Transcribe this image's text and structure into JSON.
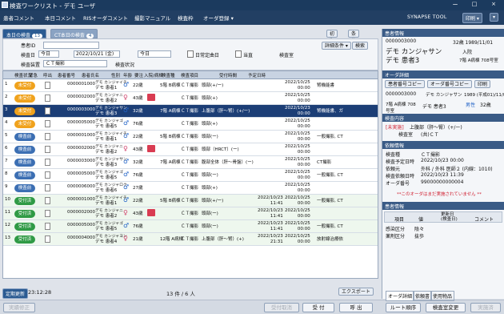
{
  "titlebar": {
    "title": "検査ワークリスト - デモ ユーザ",
    "min": "ー",
    "max": "□",
    "close": "×"
  },
  "menu": {
    "items": [
      "患者コメント",
      "本日コメント",
      "RISオーダコメント",
      "撮影マニュアル",
      "検査枠",
      "オーダ登録 ▾"
    ],
    "brand": "SYNAPSE TOOL",
    "print": "印刷 ▾",
    "more": "▾"
  },
  "tabs": {
    "tab1": "本日の検査",
    "tab1_count": "13",
    "tab2": "CT本日の検査",
    "tab2_count": "4"
  },
  "filters": {
    "init_label": "初期化",
    "cond_label": "条件リスト選択",
    "patient_id_label": "患者ID",
    "exam_date_label": "検査日",
    "date_type": "今日",
    "date_from": "2022/10/21 (金)",
    "date_to": "今日",
    "same_day": "日常定曲日",
    "inpatient": "当直",
    "exam_room_label": "検査室",
    "detail_btn": "詳細条件 ▾",
    "search_btn": "検索",
    "modality_label": "検査装置",
    "modality_value": "ＣＴ撮影",
    "status_label": "検査状況"
  },
  "grid": {
    "headers": [
      "検査状況",
      "緊急",
      "呼出",
      "患者番号",
      "患者氏名",
      "性別",
      "年齢",
      "要注",
      "入院/病棟",
      "検査種",
      "検査項目",
      "受付時間",
      "予定日時",
      ""
    ],
    "rows": [
      {
        "no": "1",
        "status": "未受付",
        "status_color": "o",
        "pid": "0000001000",
        "name_k": "デモ カンジャイチ",
        "name": "デモ 患者1",
        "sex": "m",
        "age": "22歳",
        "flag": false,
        "ward": "5階 B病棟",
        "kind": "ＣＴ撮影",
        "item": "頭部(+/ー)",
        "recv": "",
        "date": "2022/10/25\n00:00",
        "note": "腎機能書"
      },
      {
        "no": "2",
        "status": "未受付",
        "status_color": "o",
        "pid": "0000002000",
        "name_k": "デモ カンジャニ",
        "name": "デモ 患者2",
        "sex": "f",
        "age": "43歳",
        "flag": true,
        "ward": "",
        "kind": "ＣＴ撮影",
        "item": "頭部(+)",
        "recv": "",
        "date": "2022/10/25\n00:00",
        "note": ""
      },
      {
        "no": "3",
        "status": "未受付",
        "status_color": "o",
        "pid": "0000003000",
        "name_k": "デモ カンジャサン",
        "name": "デモ 患者3",
        "sex": "m",
        "age": "32歳",
        "flag": false,
        "ward": "7階 A病棟",
        "kind": "ＣＴ撮影",
        "item": "上腹部（肝〜腎）(+/ー)",
        "recv": "",
        "date": "2022/10/23\n00:00",
        "note": "腎機能書、ガ"
      },
      {
        "no": "4",
        "status": "未受付",
        "status_color": "o",
        "pid": "0000005000",
        "name_k": "デモ カンジャゴ",
        "name": "デモ 患者5",
        "sex": "m",
        "age": "76歳",
        "flag": false,
        "ward": "",
        "kind": "ＣＴ撮影",
        "item": "頭部(+)",
        "recv": "",
        "date": "2022/10/25\n00:00",
        "note": ""
      },
      {
        "no": "5",
        "status": "検査前",
        "status_color": "b",
        "pid": "0000001000",
        "name_k": "デモ カンジャイチ",
        "name": "デモ 患者1",
        "sex": "m",
        "age": "22歳",
        "flag": false,
        "ward": "5階 B病棟",
        "kind": "ＣＴ撮影",
        "item": "頭部(ー)",
        "recv": "",
        "date": "2022/10/25\n00:00",
        "note": "一般撮影, CT"
      },
      {
        "no": "6",
        "status": "検査前",
        "status_color": "b",
        "pid": "0000002000",
        "name_k": "デモ カンジャニ",
        "name": "デモ 患者2",
        "sex": "f",
        "age": "43歳",
        "flag": true,
        "ward": "",
        "kind": "ＣＴ撮影",
        "item": "頭部（HRCT）(ー)",
        "recv": "",
        "date": "2022/10/25\n00:00",
        "note": ""
      },
      {
        "no": "7",
        "status": "検査前",
        "status_color": "b",
        "pid": "0000003000",
        "name_k": "デモ カンジャサン",
        "name": "デモ 患者3",
        "sex": "m",
        "age": "32歳",
        "flag": false,
        "ward": "7階 A病棟",
        "kind": "ＣＴ撮影",
        "item": "腹部全体（肝〜骨盤）(ー)",
        "recv": "",
        "date": "2022/10/25\n00:00",
        "note": "CT撮影"
      },
      {
        "no": "8",
        "status": "検査前",
        "status_color": "b",
        "pid": "0000005000",
        "name_k": "デモ カンジャゴ",
        "name": "デモ 患者5",
        "sex": "m",
        "age": "76歳",
        "flag": false,
        "ward": "",
        "kind": "ＣＴ撮影",
        "item": "頭部(ー)",
        "recv": "",
        "date": "2022/10/25\n00:00",
        "note": "一般撮影, CT"
      },
      {
        "no": "9",
        "status": "検査前",
        "status_color": "b",
        "pid": "0000006000",
        "name_k": "デモ カンジャロク",
        "name": "デモ 患者6",
        "sex": "m",
        "age": "27歳",
        "flag": false,
        "ward": "",
        "kind": "ＣＴ撮影",
        "item": "頭部(+)",
        "recv": "",
        "date": "2022/10/25\n00:00",
        "note": ""
      },
      {
        "no": "10",
        "status": "受付済",
        "status_color": "g",
        "pid": "0000001000",
        "name_k": "デモ カンジャイチ",
        "name": "デモ 患者1",
        "sex": "m",
        "age": "22歳",
        "flag": false,
        "ward": "5階 B病棟",
        "kind": "ＣＴ撮影",
        "item": "頭部(+/ー)",
        "recv": "2022/10/23\n11:41",
        "date": "2022/10/25\n00:00",
        "note": "一般撮影, CT"
      },
      {
        "no": "11",
        "status": "受付済",
        "status_color": "g",
        "pid": "0000002000",
        "name_k": "デモ カンジャニ",
        "name": "デモ 患者2",
        "sex": "f",
        "age": "43歳",
        "flag": true,
        "ward": "",
        "kind": "ＣＴ撮影",
        "item": "頭部(ー)",
        "recv": "2022/10/23\n11:41",
        "date": "2022/10/25\n00:00",
        "note": ""
      },
      {
        "no": "12",
        "status": "受付済",
        "status_color": "g",
        "pid": "0000005000",
        "name_k": "デモ カンジャゴ",
        "name": "デモ 患者5",
        "sex": "m",
        "age": "76歳",
        "flag": false,
        "ward": "",
        "kind": "ＣＴ撮影",
        "item": "頭部(ー)",
        "recv": "2022/10/23\n11:41",
        "date": "2022/10/25\n00:00",
        "note": "一般撮影, CT"
      },
      {
        "no": "13",
        "status": "受付済",
        "status_color": "g",
        "pid": "0000004000",
        "name_k": "デモ カンジャヨン",
        "name": "デモ 患者4",
        "sex": "f",
        "age": "21歳",
        "flag": false,
        "ward": "12階 A病棟",
        "kind": "ＣＴ撮影",
        "item": "上腹部（肝〜腎）(+)",
        "recv": "2022/10/23\n21:31",
        "date": "2022/10/25\n00:00",
        "note": "放射線治療依"
      }
    ]
  },
  "footer": {
    "update_label": "定期更新",
    "time": "23:12:28",
    "count": "13 件 / 6 人",
    "export": "エクスポート"
  },
  "bottombar": {
    "cancel_fix": "実績修正",
    "cancel_recv": "受付取消",
    "accept": "受 付",
    "call": "呼 出",
    "route": "ルート順序",
    "change": "検査室変更",
    "exam_done": "実施済"
  },
  "side": {
    "patient_header": "患者情報",
    "pid": "0000003000",
    "dob": "32歳 1989/11/01",
    "name_k": "デモ カンジャサン",
    "ward_status": "入院",
    "name": "デモ 患者3",
    "ward": "7階 A病棟 708号室",
    "order_header": "オーダ詳細",
    "btn_copy_pid": "患者番号コピー",
    "btn_copy_order": "オーダ番号コピー",
    "btn_print": "印刷",
    "o_pid": "0000003000",
    "o_name_k": "デモ カンジャサン",
    "o_dob": "1989 (平成01)/11/01",
    "o_ward": "7階 A病棟 708号室",
    "o_name": "デモ 患者3",
    "o_sex": "男性",
    "o_age": "32歳",
    "purpose_header": "検査内容",
    "purpose_tag": "[未実施]",
    "purpose_item": "上腹部（肝〜腎）(+/ー)",
    "purpose_sub_label": "検査室",
    "purpose_sub": "(共)ＣＴ",
    "info_header": "依頼情報",
    "info": [
      [
        "検査種",
        "ＣＴ撮影"
      ],
      [
        "検査予定日時",
        "2022/10/23 00:00"
      ],
      [
        "依頼元",
        "外科 / 外科 医師２ (内線：1010)"
      ],
      [
        "検査依頼日時",
        "2022/10/23 11:39"
      ],
      [
        "オーダ番号",
        "99000000000004"
      ]
    ],
    "warning": "**このオーダはまだ実施されていません **",
    "vital_header": "患者情報",
    "vital_cols": [
      "項目",
      "値",
      "更新日\n(検査日)",
      "コメント"
    ],
    "vital_rows": [
      [
        "感染区分",
        "陰々"
      ],
      [
        "薬剤区分",
        "抜歩"
      ]
    ],
    "bottom_tabs": [
      "オーダ詳細",
      "依頼書",
      "使用物品"
    ]
  }
}
